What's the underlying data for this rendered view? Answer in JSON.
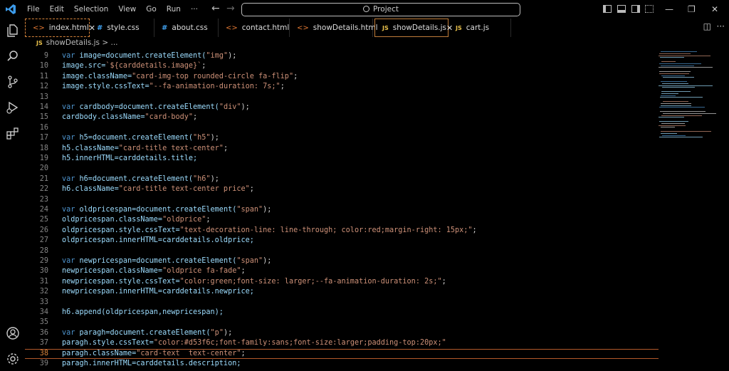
{
  "menu": [
    "File",
    "Edit",
    "Selection",
    "View",
    "Go",
    "Run",
    "···"
  ],
  "search": {
    "label": "Project"
  },
  "tabs": [
    {
      "label": "index.html",
      "type": "html"
    },
    {
      "label": "style.css",
      "type": "css"
    },
    {
      "label": "about.css",
      "type": "css"
    },
    {
      "label": "contact.html",
      "type": "html"
    },
    {
      "label": "showDetails.html",
      "type": "html"
    },
    {
      "label": "showDetails.js",
      "type": "js"
    },
    {
      "label": "cart.js",
      "type": "js"
    }
  ],
  "breadcrumb": {
    "file": "showDetails.js",
    "sep": "> ...",
    "js_badge": "JS"
  },
  "code": {
    "l9": {
      "n": "9",
      "kw": "var",
      "rest": " image=document.createElement(",
      "str": "\"img\"",
      "end": ");"
    },
    "l10": {
      "n": "10",
      "a": "image.src=",
      "str": "`${carddetails.image}`",
      "end": ";"
    },
    "l11": {
      "n": "11",
      "a": "image.className=",
      "str": "\"card-img-top rounded-circle fa-flip\"",
      "end": ";"
    },
    "l12": {
      "n": "12",
      "a": "image.style.cssText=",
      "str": "\"--fa-animation-duration: 7s;\"",
      "end": ";"
    },
    "l13": {
      "n": "13"
    },
    "l14": {
      "n": "14",
      "kw": "var",
      "rest": " cardbody=document.createElement(",
      "str": "\"div\"",
      "end": ");"
    },
    "l15": {
      "n": "15",
      "a": "cardbody.className=",
      "str": "\"card-body\"",
      "end": ";"
    },
    "l16": {
      "n": "16"
    },
    "l17": {
      "n": "17",
      "kw": "var",
      "rest": " h5=document.createElement(",
      "str": "\"h5\"",
      "end": ");"
    },
    "l18": {
      "n": "18",
      "a": "h5.className=",
      "str": "\"card-title text-center\"",
      "end": ";"
    },
    "l19": {
      "n": "19",
      "a": "h5.innerHTML=carddetails.title;"
    },
    "l20": {
      "n": "20"
    },
    "l21": {
      "n": "21",
      "kw": "var",
      "rest": " h6=document.createElement(",
      "str": "\"h6\"",
      "end": ");"
    },
    "l22": {
      "n": "22",
      "a": "h6.className=",
      "str": "\"card-title text-center price\"",
      "end": ";"
    },
    "l23": {
      "n": "23"
    },
    "l24": {
      "n": "24",
      "kw": "var",
      "rest": " oldpricespan=document.createElement(",
      "str": "\"span\"",
      "end": ");"
    },
    "l25": {
      "n": "25",
      "a": "oldpricespan.className=",
      "str": "\"oldprice\"",
      "end": ";"
    },
    "l26": {
      "n": "26",
      "a": "oldpricespan.style.cssText=",
      "str": "\"text-decoration-line: line-through; color:red;margin-right: 15px;\"",
      "end": ";"
    },
    "l27": {
      "n": "27",
      "a": "oldpricespan.innerHTML=carddetails.oldprice;"
    },
    "l28": {
      "n": "28"
    },
    "l29": {
      "n": "29",
      "kw": "var",
      "rest": " newpricespan=document.createElement(",
      "str": "\"span\"",
      "end": ");"
    },
    "l30": {
      "n": "30",
      "a": "newpricespan.className=",
      "str": "\"oldprice fa-fade\"",
      "end": ";"
    },
    "l31": {
      "n": "31",
      "a": "newpricespan.style.cssText=",
      "str": "\"color:green;font-size: larger;--fa-animation-duration: 2s;\"",
      "end": ";"
    },
    "l32": {
      "n": "32",
      "a": "newpricespan.innerHTML=carddetails.newprice;"
    },
    "l33": {
      "n": "33"
    },
    "l34": {
      "n": "34",
      "a": "h6.append(oldpricespan,newpricespan);"
    },
    "l35": {
      "n": "35"
    },
    "l36": {
      "n": "36",
      "kw": "var",
      "rest": " paragh=document.createElement(",
      "str": "\"p\"",
      "end": ");"
    },
    "l37": {
      "n": "37",
      "a": "paragh.style.cssText=",
      "str": "\"color:#d53f6c;font-family:sans;font-size:larger;padding-top:20px;\""
    },
    "l38": {
      "n": "38",
      "a": "paragh.className=",
      "str": "\"card-text  text-center\"",
      "end": ";"
    },
    "l39": {
      "n": "39",
      "a": "paragh.innerHTML=carddetails.description;"
    }
  },
  "colors": {
    "accent": "#d7843b",
    "keyword": "#4e94ce",
    "string": "#ce9178",
    "identifier": "#9cdcfe"
  },
  "icons": [
    "vscode-logo-icon",
    "explorer-icon",
    "search-icon",
    "source-control-icon",
    "run-debug-icon",
    "extensions-icon",
    "account-icon",
    "settings-gear-icon"
  ]
}
